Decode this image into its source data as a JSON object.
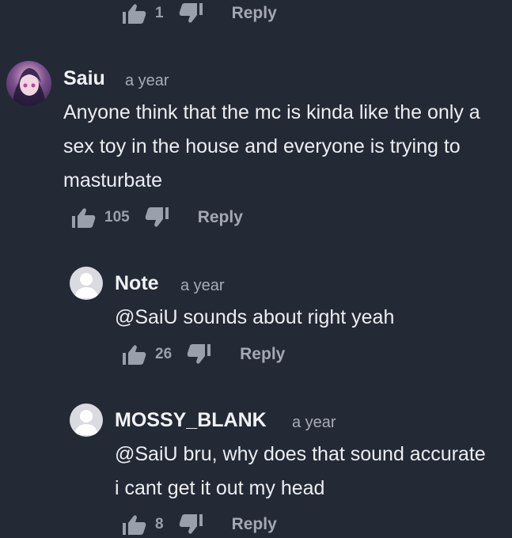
{
  "top_actions": {
    "likes": "1",
    "reply_label": "Reply"
  },
  "comments": [
    {
      "author": "Saiu",
      "time": "a year",
      "text": "Anyone think that the mc is kinda like the only a sex toy in the house and everyone is trying to masturbate",
      "likes": "105",
      "reply_label": "Reply",
      "avatar": "anime-avatar"
    },
    {
      "author": "Note",
      "time": "a year",
      "text": "@SaiU sounds about right yeah",
      "likes": "26",
      "reply_label": "Reply",
      "avatar": "default-avatar"
    },
    {
      "author": "MOSSY_BLANK",
      "time": "a year",
      "text": "@SaiU bru, why does that sound accurate i cant get it out my head",
      "likes": "8",
      "reply_label": "Reply",
      "avatar": "default-avatar"
    }
  ],
  "colors": {
    "background": "#242936",
    "text": "#eceef2",
    "muted": "#9aa0ab"
  },
  "icons": [
    "thumbs-up-icon",
    "thumbs-down-icon",
    "user-icon"
  ]
}
